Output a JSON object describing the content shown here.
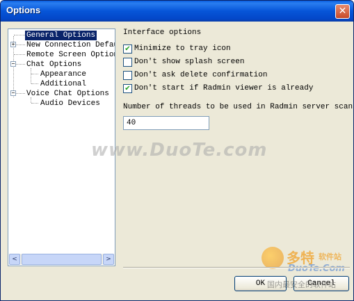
{
  "window": {
    "title": "Options",
    "close_symbol": "✕"
  },
  "tree": {
    "items": [
      {
        "label": "General Options",
        "selected": true
      },
      {
        "label": "New Connection Defaul"
      },
      {
        "label": "Remote Screen Options"
      },
      {
        "label": "Chat Options"
      },
      {
        "label": "Appearance"
      },
      {
        "label": "Additional"
      },
      {
        "label": "Voice Chat Options"
      },
      {
        "label": "Audio Devices"
      }
    ],
    "expanders": {
      "plus": "+",
      "minus": "−"
    },
    "scroll": {
      "left": "<",
      "right": ">"
    }
  },
  "interface": {
    "heading": "Interface options",
    "checkboxes": [
      {
        "label": "Minimize to tray icon",
        "checked": true
      },
      {
        "label": "Don't show splash screen",
        "checked": false
      },
      {
        "label": "Don't ask delete confirmation",
        "checked": false
      },
      {
        "label": "Don't start if Radmin viewer is already",
        "checked": true
      }
    ],
    "check_mark": "✔",
    "threads_label": "Number of threads to be used in Radmin server scans",
    "threads_value": "40"
  },
  "buttons": {
    "ok": "OK",
    "cancel": "Cancel"
  },
  "watermark": {
    "main": "www.DuoTe.com",
    "logo_cn": "多特",
    "logo_sub": "软件站",
    "logo_en": "DuoTe.Com",
    "overlay": "国内最安全的软件站"
  }
}
